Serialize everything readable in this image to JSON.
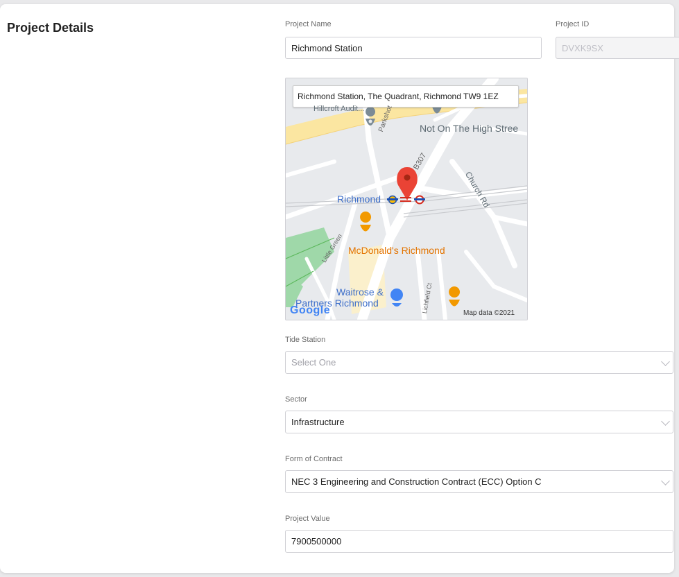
{
  "section_title": "Project Details",
  "project_name": {
    "label": "Project Name",
    "value": "Richmond Station"
  },
  "project_id": {
    "label": "Project ID",
    "value": "DVXK9SX"
  },
  "map": {
    "search_value": "Richmond Station, The Quadrant, Richmond TW9 1EZ",
    "labels": {
      "hillcroft": "Hillcroft Audit...",
      "not_on_high_street": "Not On The High Stree",
      "parkshot": "Parkshot",
      "b307": "B307",
      "church_rd": "Church Rd",
      "richmond": "Richmond",
      "little_green": "Little Green",
      "mcdonalds": "McDonald's Richmond",
      "lichfield_ct": "Lichfield Ct",
      "waitrose": "Waitrose &",
      "waitrose2": "Partners Richmond",
      "google": "Google",
      "map_data": "Map data ©2021"
    }
  },
  "tide_station": {
    "label": "Tide Station",
    "placeholder": "Select One"
  },
  "sector": {
    "label": "Sector",
    "value": "Infrastructure"
  },
  "form_of_contract": {
    "label": "Form of Contract",
    "value": "NEC 3 Engineering and Construction Contract (ECC) Option C"
  },
  "project_value": {
    "label": "Project Value",
    "value": "7900500000"
  }
}
